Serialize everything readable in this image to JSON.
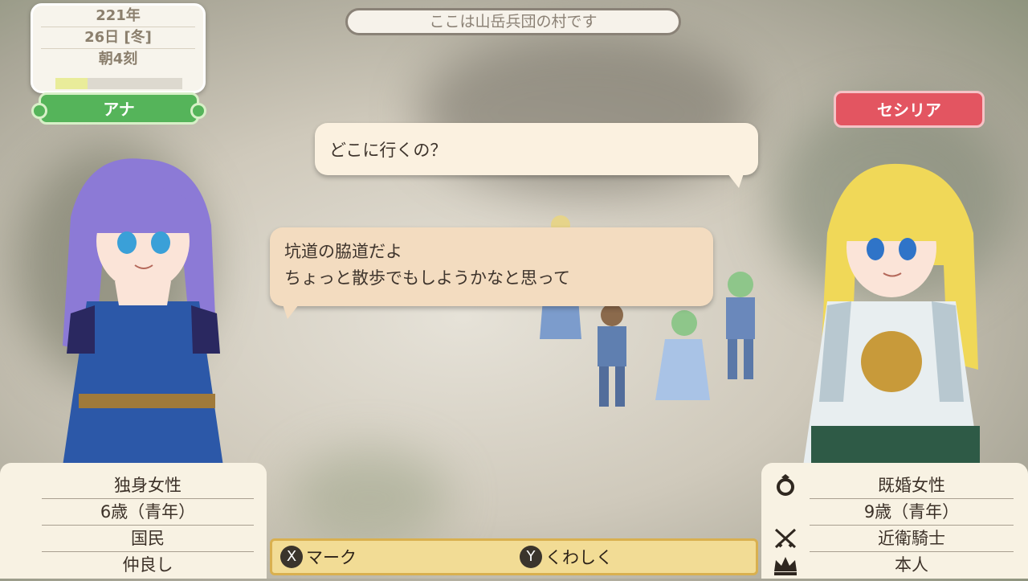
{
  "date": {
    "year": "221年",
    "day": "26日 [冬]",
    "time": "朝4刻",
    "time_progress": 0.25
  },
  "location": "ここは山岳兵団の村です",
  "left_character": {
    "name": "アナ",
    "info": [
      "独身女性",
      "6歳（青年）",
      "国民",
      "仲良し"
    ]
  },
  "right_character": {
    "name": "セシリア",
    "info": [
      "既婚女性",
      "9歳（青年）",
      "近衛騎士",
      "本人"
    ],
    "icons": [
      "ring-icon",
      "crossed-swords-icon",
      "crown-icon"
    ]
  },
  "dialogue": {
    "line1": "どこに行くの？",
    "line2a": "坑道の脇道だよ",
    "line2b": "ちょっと散歩でもしようかなと思って"
  },
  "prompt": {
    "x_button": "X",
    "x_label": "マーク",
    "y_button": "Y",
    "y_label": "くわしく"
  },
  "colors": {
    "left_tag": "#55b45a",
    "right_tag": "#e35561"
  }
}
